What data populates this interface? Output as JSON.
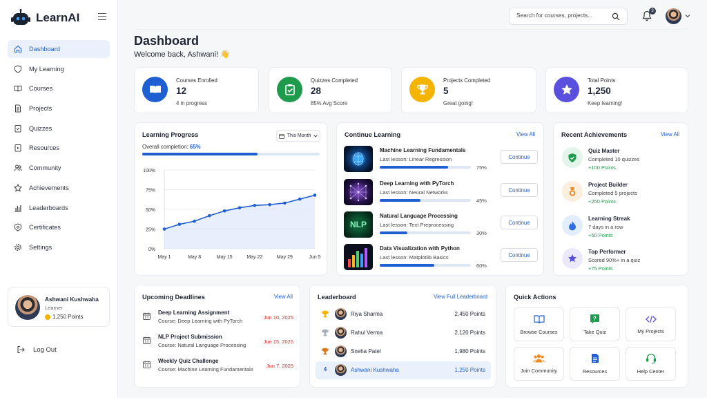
{
  "app": {
    "name": "LearnAI"
  },
  "sidebar": {
    "items": [
      {
        "label": "Dashboard",
        "icon": "home-icon",
        "active": true
      },
      {
        "label": "My Learning",
        "icon": "shield-book-icon"
      },
      {
        "label": "Courses",
        "icon": "book-icon"
      },
      {
        "label": "Projects",
        "icon": "document-icon"
      },
      {
        "label": "Quizzes",
        "icon": "quiz-icon"
      },
      {
        "label": "Resources",
        "icon": "file-icon"
      },
      {
        "label": "Community",
        "icon": "users-icon"
      },
      {
        "label": "Achievements",
        "icon": "star-icon"
      },
      {
        "label": "Leaderboards",
        "icon": "bar-chart-icon"
      },
      {
        "label": "Certificates",
        "icon": "certificate-icon"
      },
      {
        "label": "Settings",
        "icon": "gear-icon"
      }
    ],
    "user": {
      "name": "Ashwani Kushwaha",
      "role": "Learner",
      "points": "1,250 Points"
    },
    "logout_label": "Log Out"
  },
  "header": {
    "search_placeholder": "Search for courses, projects...",
    "notification_count": "3"
  },
  "page": {
    "title": "Dashboard",
    "welcome": "Welcome back, Ashwani! 👋"
  },
  "stats": [
    {
      "label": "Courses Enrolled",
      "value": "12",
      "sub": "4 in progress",
      "color": "#1f5fd1"
    },
    {
      "label": "Quizzes Completed",
      "value": "28",
      "sub": "85% Avg Score",
      "color": "#1e9b4c"
    },
    {
      "label": "Projects Completed",
      "value": "5",
      "sub": "Great going!",
      "color": "#f4b400"
    },
    {
      "label": "Total Points",
      "value": "1,250",
      "sub": "Keep learning!",
      "color": "#5b4fe0"
    }
  ],
  "progress": {
    "title": "Learning Progress",
    "period": "This Month",
    "overall_label": "Overall completion:",
    "overall_value": "65%",
    "overall_fraction": 0.65
  },
  "chart_data": {
    "type": "area",
    "x": [
      "May 1",
      "May 4",
      "May 8",
      "May 11",
      "May 15",
      "May 18",
      "May 22",
      "May 25",
      "May 29",
      "Jun 1",
      "Jun 5"
    ],
    "x_tick_labels": [
      "May 1",
      "May 8",
      "May 15",
      "May 22",
      "May 29",
      "Jun 5"
    ],
    "y_tick_labels": [
      "100%",
      "75%",
      "50%",
      "25%",
      "0%"
    ],
    "values": [
      25,
      31,
      35,
      42,
      48,
      52,
      55,
      56,
      58,
      63,
      68
    ],
    "ylim": [
      0,
      100
    ],
    "grid": true,
    "color": "#1f5fd1"
  },
  "continue": {
    "title": "Continue Learning",
    "view_all": "View All",
    "button_label": "Continue",
    "lesson_prefix": "Last lesson: ",
    "courses": [
      {
        "title": "Machine Learning Fundamentals",
        "lesson": "Linear Regression",
        "progress": "75%",
        "fraction": 0.75
      },
      {
        "title": "Deep Learning with PyTorch",
        "lesson": "Neural Networks",
        "progress": "45%",
        "fraction": 0.45
      },
      {
        "title": "Natural Language Processing",
        "lesson": "Text Preprocessing",
        "progress": "30%",
        "fraction": 0.3,
        "thumb_text": "NLP"
      },
      {
        "title": "Data Visualization with Python",
        "lesson": "Matplotlib Basics",
        "progress": "60%",
        "fraction": 0.6
      }
    ]
  },
  "achievements": {
    "title": "Recent Achievements",
    "view_all": "View All",
    "items": [
      {
        "title": "Quiz Master",
        "desc": "Completed 10 quizzes",
        "points": "+100 Points"
      },
      {
        "title": "Project Builder",
        "desc": "Completed 5 projects",
        "points": "+250 Points"
      },
      {
        "title": "Learning Streak",
        "desc": "7 days in a row",
        "points": "+50 Points"
      },
      {
        "title": "Top Performer",
        "desc": "Scored 90%+ in a quiz",
        "points": "+75 Points"
      }
    ]
  },
  "deadlines": {
    "title": "Upcoming Deadlines",
    "view_all": "View All",
    "items": [
      {
        "title": "Deep Learning Assignment",
        "course": "Course: Deep Learning with PyTorch",
        "date": "Jun 10, 2025"
      },
      {
        "title": "NLP Project Submission",
        "course": "Course: Natural Language Processing",
        "date": "Jun 15, 2025"
      },
      {
        "title": "Weekly Quiz Challenge",
        "course": "Course: Machine Learning Fundamentals",
        "date": "Jun 7, 2025"
      }
    ]
  },
  "leaderboard": {
    "title": "Leaderboard",
    "view_full": "View Full Leaderboard",
    "rows": [
      {
        "rank": "",
        "name": "Riya Sharma",
        "points": "2,450 Points"
      },
      {
        "rank": "",
        "name": "Rahul Verma",
        "points": "2,120 Points"
      },
      {
        "rank": "",
        "name": "Sneha Patel",
        "points": "1,980 Points"
      },
      {
        "rank": "4",
        "name": "Ashwani Kushwaha",
        "points": "1,250 Points"
      }
    ]
  },
  "quick_actions": {
    "title": "Quick Actions",
    "items": [
      {
        "label": "Browse Courses",
        "icon": "book-icon"
      },
      {
        "label": "Take Quiz",
        "icon": "question-icon"
      },
      {
        "label": "My Projects",
        "icon": "code-icon"
      },
      {
        "label": "Join Community",
        "icon": "users-icon"
      },
      {
        "label": "Resources",
        "icon": "document-icon"
      },
      {
        "label": "Help Center",
        "icon": "headset-icon"
      }
    ]
  }
}
